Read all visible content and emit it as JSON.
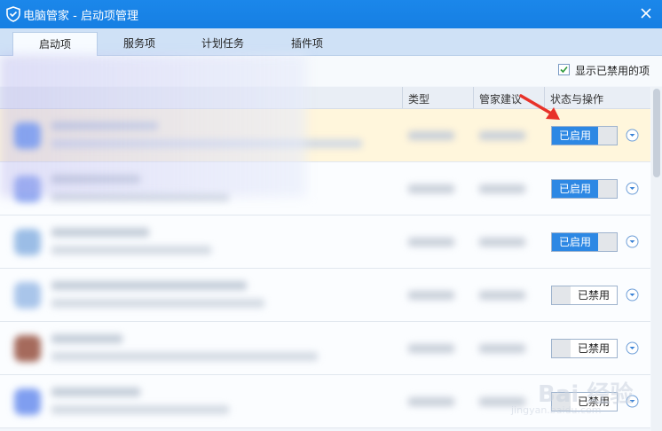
{
  "window": {
    "title": "电脑管家 - 启动项管理",
    "close_icon": "close-icon",
    "logo_icon": "shield-icon"
  },
  "tabs": [
    {
      "label": "启动项",
      "active": true
    },
    {
      "label": "服务项",
      "active": false
    },
    {
      "label": "计划任务",
      "active": false
    },
    {
      "label": "插件项",
      "active": false
    }
  ],
  "filter": {
    "show_disabled_label": "显示已禁用的项",
    "show_disabled_checked": true
  },
  "table": {
    "columns": {
      "type": "类型",
      "advice": "管家建议",
      "status": "状态与操作"
    },
    "rows": [
      {
        "state_label": "已启用",
        "enabled": true,
        "highlight": true,
        "icon_color": "#6a9af0"
      },
      {
        "state_label": "已启用",
        "enabled": true,
        "highlight": false,
        "icon_color": "#8ea9f2"
      },
      {
        "state_label": "已启用",
        "enabled": true,
        "highlight": false,
        "icon_color": "#9bbde6"
      },
      {
        "state_label": "已禁用",
        "enabled": false,
        "highlight": false,
        "icon_color": "#a9c5ea"
      },
      {
        "state_label": "已禁用",
        "enabled": false,
        "highlight": false,
        "icon_color": "#a56a5c"
      },
      {
        "state_label": "已禁用",
        "enabled": false,
        "highlight": false,
        "icon_color": "#7f9ef0"
      }
    ]
  },
  "watermark": {
    "text": "Bai 经验",
    "sub": "jingyan.baidu.com"
  },
  "colors": {
    "accent": "#2d88e4",
    "titlebar": "#1b87ea",
    "highlight_row": "#fff6dc",
    "arrow": "#e8322a"
  }
}
